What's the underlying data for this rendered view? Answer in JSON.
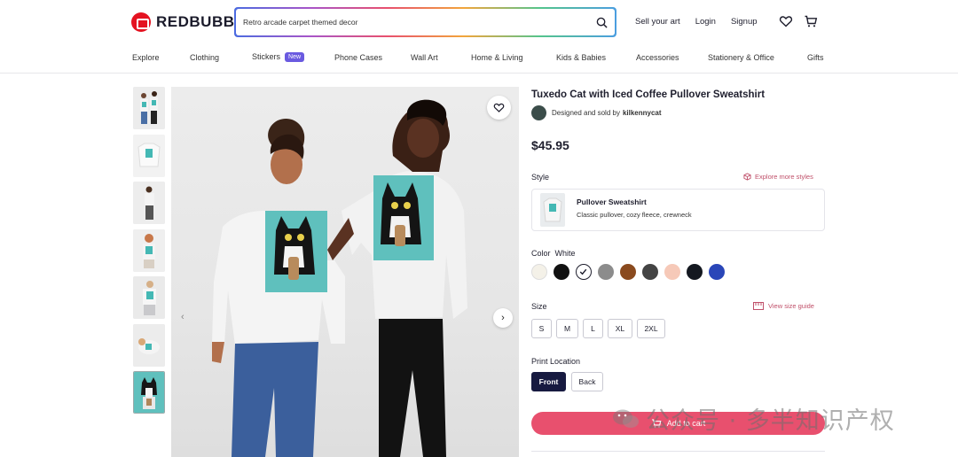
{
  "brand": {
    "name": "REDBUBBLE",
    "color": "#e41321"
  },
  "search": {
    "value": "Retro arcade carpet themed decor"
  },
  "top_links": {
    "sell": "Sell your art",
    "login": "Login",
    "signup": "Signup"
  },
  "nav": {
    "items": [
      "Explore",
      "Clothing",
      "Stickers",
      "Phone Cases",
      "Wall Art",
      "Home & Living",
      "Kids & Babies",
      "Accessories",
      "Stationery & Office",
      "Gifts"
    ],
    "badge": "New"
  },
  "product": {
    "title": "Tuxedo Cat with Iced Coffee Pullover Sweatshirt",
    "seller_prefix": "Designed and sold by",
    "seller_name": "kilkennycat",
    "price": "$45.95"
  },
  "style": {
    "label": "Style",
    "explore_link": "Explore more styles",
    "name": "Pullover Sweatshirt",
    "description": "Classic pullover, cozy fleece, crewneck"
  },
  "color": {
    "label": "Color",
    "selected": "White",
    "swatches": [
      "#f4f1e8",
      "#111111",
      "#ffffff",
      "#8c8c8c",
      "#8a4a1e",
      "#444444",
      "#f6c9b8",
      "#141820",
      "#2a46b8"
    ]
  },
  "size": {
    "label": "Size",
    "guide_link": "View size guide",
    "options": [
      "S",
      "M",
      "L",
      "XL",
      "2XL"
    ]
  },
  "print_location": {
    "label": "Print Location",
    "options": [
      "Front",
      "Back"
    ],
    "selected": "Front"
  },
  "cart": {
    "label": "Add to cart"
  },
  "watermark": "公众号 · 多半知识产权",
  "colors": {
    "accent": "#e8506e",
    "dark": "#171a40",
    "badge": "#6a5ae0"
  }
}
